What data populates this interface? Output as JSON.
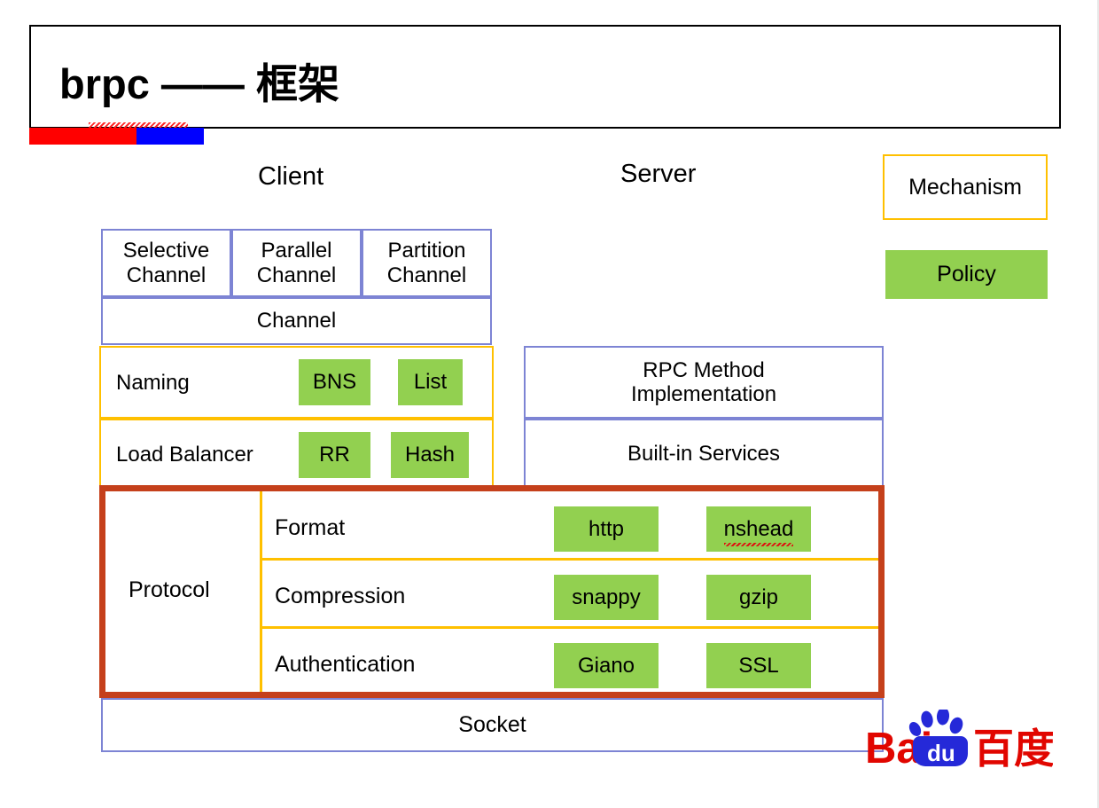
{
  "slide": {
    "title": "brpc —— 框架",
    "title_main": "brpc",
    "title_dash": "——",
    "title_cn": "框架"
  },
  "headings": {
    "client": "Client",
    "server": "Server"
  },
  "legend": {
    "mechanism": "Mechanism",
    "policy": "Policy"
  },
  "client": {
    "channels": [
      {
        "line1": "Selective",
        "line2": "Channel"
      },
      {
        "line1": "Parallel",
        "line2": "Channel"
      },
      {
        "line1": "Partition",
        "line2": "Channel"
      }
    ],
    "channel_base": "Channel",
    "naming": {
      "label": "Naming",
      "chips": [
        "BNS",
        "List"
      ]
    },
    "load_balancer": {
      "label": "Load Balancer",
      "chips": [
        "RR",
        "Hash"
      ]
    }
  },
  "server": {
    "rpc_method": "RPC Method\nImplementation",
    "rpc_method_line1": "RPC Method",
    "rpc_method_line2": "Implementation",
    "built_in_services": "Built-in Services"
  },
  "protocol": {
    "label": "Protocol",
    "rows": [
      {
        "label": "Format",
        "chips": [
          "http",
          "nshead"
        ]
      },
      {
        "label": "Compression",
        "chips": [
          "snappy",
          "gzip"
        ]
      },
      {
        "label": "Authentication",
        "chips": [
          "Giano",
          "SSL"
        ]
      }
    ]
  },
  "socket": {
    "label": "Socket"
  },
  "logo": {
    "name": "baidu-logo",
    "text_latin": "Bai",
    "text_paw_label": "du",
    "text_cn": "百度"
  },
  "colors": {
    "mechanism_border": "#FFC000",
    "policy_fill": "#92D050",
    "channel_border": "#7D84D4",
    "protocol_border": "#C5401B",
    "accent_red": "#FF0000",
    "accent_blue": "#0000FF",
    "logo_red": "#E10600",
    "logo_blue": "#2529D8",
    "text": "#000000"
  }
}
